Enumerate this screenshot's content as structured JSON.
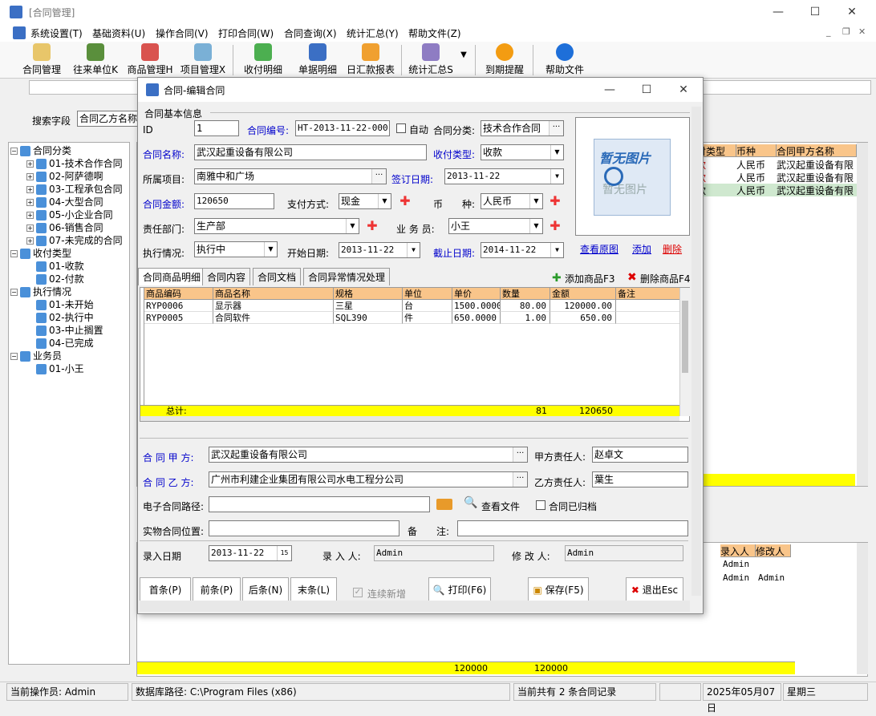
{
  "window": {
    "title": "[合同管理]"
  },
  "menu": [
    "系统设置(T)",
    "基础资料(U)",
    "操作合同(V)",
    "打印合同(W)",
    "合同查询(X)",
    "统计汇总(Y)",
    "帮助文件(Z)"
  ],
  "toolbar": [
    "合同管理",
    "往来单位K",
    "商品管理H",
    "项目管理X",
    "收付明细",
    "单据明细",
    "日汇款报表",
    "统计汇总S",
    "到期提醒",
    "帮助文件"
  ],
  "search": {
    "label": "搜索字段",
    "value": "合同乙方名称"
  },
  "tree": [
    {
      "text": "合同分类",
      "level": 0,
      "box": "−"
    },
    {
      "text": "01-技术合作合同",
      "level": 1,
      "box": "+"
    },
    {
      "text": "02-阿萨德啊",
      "level": 1,
      "box": "+"
    },
    {
      "text": "03-工程承包合同",
      "level": 1,
      "box": "+"
    },
    {
      "text": "04-大型合同",
      "level": 1,
      "box": "+"
    },
    {
      "text": "05-小企业合同",
      "level": 1,
      "box": "+"
    },
    {
      "text": "06-销售合同",
      "level": 1,
      "box": "+"
    },
    {
      "text": "07-未完成的合同",
      "level": 1,
      "box": "+"
    },
    {
      "text": "收付类型",
      "level": 0,
      "box": "−"
    },
    {
      "text": "01-收款",
      "level": 1,
      "box": ""
    },
    {
      "text": "02-付款",
      "level": 1,
      "box": ""
    },
    {
      "text": "执行情况",
      "level": 0,
      "box": "−"
    },
    {
      "text": "01-未开始",
      "level": 1,
      "box": ""
    },
    {
      "text": "02-执行中",
      "level": 1,
      "box": ""
    },
    {
      "text": "03-中止搁置",
      "level": 1,
      "box": ""
    },
    {
      "text": "04-已完成",
      "level": 1,
      "box": ""
    },
    {
      "text": "业务员",
      "level": 0,
      "box": "−"
    },
    {
      "text": "01-小王",
      "level": 1,
      "box": ""
    }
  ],
  "bg_grid": {
    "headers": [
      "付类型",
      "币种",
      "合同甲方名称"
    ],
    "rows": [
      [
        "款",
        "人民币",
        "武汉起重设备有限"
      ],
      [
        "款",
        "人民币",
        "武汉起重设备有限"
      ],
      [
        "款",
        "人民币",
        "武汉起重设备有限"
      ]
    ],
    "headers2": [
      "录入人",
      "修改人"
    ],
    "rows2": [
      [
        "Admin",
        ""
      ],
      [
        "Admin",
        "Admin"
      ]
    ],
    "totals": [
      "120000",
      "120000"
    ]
  },
  "dialog": {
    "title": "合同-编辑合同",
    "section": "合同基本信息",
    "id_label": "ID",
    "id_value": "1",
    "contract_no_label": "合同编号:",
    "contract_no": "HT-2013-11-22-0001",
    "auto_label": "自动",
    "category_label": "合同分类:",
    "category": "技术合作合同",
    "name_label": "合同名称:",
    "name": "武汉起重设备有限公司",
    "pay_type_label": "收付类型:",
    "pay_type": "收款",
    "project_label": "所属项目:",
    "project": "南雅中和广场",
    "sign_date_label": "签订日期:",
    "sign_date": "2013-11-22",
    "amount_label": "合同金额:",
    "amount": "120650",
    "pay_method_label": "支付方式:",
    "pay_method": "现金",
    "currency_label": "币　　种:",
    "currency": "人民币",
    "dept_label": "责任部门:",
    "dept": "生产部",
    "salesman_label": "业 务 员:",
    "salesman": "小王",
    "status_label": "执行情况:",
    "status": "执行中",
    "start_label": "开始日期:",
    "start_date": "2013-11-22",
    "end_label": "截止日期:",
    "end_date": "2014-11-22",
    "image_title": "暂无图片",
    "image_sub": "暂无图片",
    "view_image": "查看原图",
    "add": "添加",
    "delete": "删除",
    "tabs": [
      "合同商品明细",
      "合同内容",
      "合同文档",
      "合同异常情况处理"
    ],
    "add_goods": "添加商品F3",
    "del_goods": "删除商品F4",
    "grid_headers": [
      "商品编码",
      "商品名称",
      "规格",
      "单位",
      "单价",
      "数量",
      "金额",
      "备注"
    ],
    "grid_rows": [
      [
        "RYP0006",
        "显示器",
        "三星",
        "台",
        "1500.0000",
        "80.00",
        "120000.00",
        ""
      ],
      [
        "RYP0005",
        "合同软件",
        "SQL390",
        "件",
        "650.0000",
        "1.00",
        "650.00",
        ""
      ]
    ],
    "total_label": "总计:",
    "total_qty": "81",
    "total_amount": "120650",
    "party_a_label": "合 同 甲 方:",
    "party_a": "武汉起重设备有限公司",
    "party_a_person_label": "甲方责任人:",
    "party_a_person": "赵卓文",
    "party_b_label": "合 同 乙 方:",
    "party_b": "广州市利建企业集团有限公司水电工程分公司",
    "party_b_person_label": "乙方责任人:",
    "party_b_person": "葉生",
    "epath_label": "电子合同路径:",
    "epath": "",
    "view_file": "查看文件",
    "archived_label": "合同已归档",
    "location_label": "实物合同位置:",
    "location": "",
    "remark_label": "备　　注:",
    "remark": "",
    "entry_date_label": "录入日期",
    "entry_date": "2013-11-22",
    "entry_user_label": "录 入 人:",
    "entry_user": "Admin",
    "modifier_label": "修 改 人:",
    "modifier": "Admin",
    "buttons": [
      "首条(P)",
      "前条(P)",
      "后条(N)",
      "末条(L)",
      "连续新增",
      "打印(F6)",
      "保存(F5)",
      "退出Esc"
    ]
  },
  "status": {
    "operator": "当前操作员: Admin",
    "db_path": "数据库路径:  C:\\Program Files (x86)",
    "count": "当前共有 2 条合同记录",
    "date": "2025年05月07日",
    "weekday": "星期三"
  }
}
